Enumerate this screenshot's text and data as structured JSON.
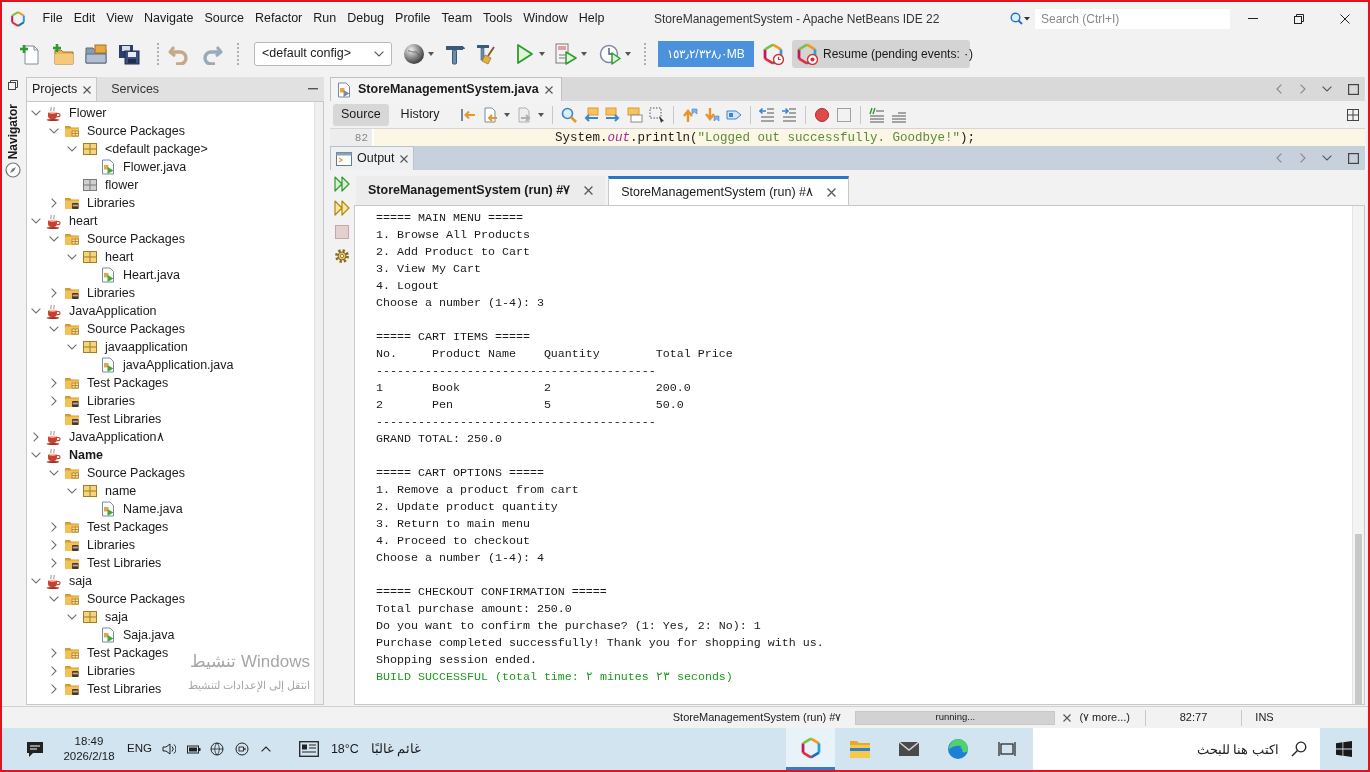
{
  "window": {
    "title": "StoreManagementSystem - Apache NetBeans IDE 22"
  },
  "menu": [
    "File",
    "Edit",
    "View",
    "Navigate",
    "Source",
    "Refactor",
    "Run",
    "Debug",
    "Profile",
    "Team",
    "Tools",
    "Window",
    "Help"
  ],
  "search": {
    "placeholder": "Search (Ctrl+I)"
  },
  "toolbar": {
    "config": "<default config>",
    "memory": "١٥٣٫٢/٣٢٨٫٠MB",
    "resume": "Resume (pending events: ٠)"
  },
  "navigator": {
    "label": "Navigator"
  },
  "projects_panel": {
    "tabs": [
      {
        "label": "Projects",
        "selected": true
      },
      {
        "label": "Services",
        "selected": false
      }
    ],
    "tree": [
      {
        "label": "Flower",
        "kind": "project",
        "main": false,
        "expanded": true,
        "children": [
          {
            "label": "Source Packages",
            "kind": "source-packages",
            "expanded": true,
            "children": [
              {
                "label": "<default package>",
                "kind": "package",
                "expanded": true,
                "children": [
                  {
                    "label": "Flower.java",
                    "kind": "java-file"
                  }
                ]
              },
              {
                "label": "flower",
                "kind": "empty-package"
              }
            ]
          },
          {
            "label": "Libraries",
            "kind": "libraries",
            "expanded": false
          }
        ]
      },
      {
        "label": "heart",
        "kind": "project",
        "main": false,
        "expanded": true,
        "children": [
          {
            "label": "Source Packages",
            "kind": "source-packages",
            "expanded": true,
            "children": [
              {
                "label": "heart",
                "kind": "package",
                "expanded": true,
                "children": [
                  {
                    "label": "Heart.java",
                    "kind": "java-file"
                  }
                ]
              }
            ]
          },
          {
            "label": "Libraries",
            "kind": "libraries",
            "expanded": false
          }
        ]
      },
      {
        "label": "JavaApplication",
        "kind": "project",
        "main": false,
        "expanded": true,
        "children": [
          {
            "label": "Source Packages",
            "kind": "source-packages",
            "expanded": true,
            "children": [
              {
                "label": "javaapplication",
                "kind": "package",
                "expanded": true,
                "children": [
                  {
                    "label": "javaApplication.java",
                    "kind": "java-file"
                  }
                ]
              }
            ]
          },
          {
            "label": "Test Packages",
            "kind": "test-packages",
            "expanded": false
          },
          {
            "label": "Libraries",
            "kind": "libraries",
            "expanded": false
          },
          {
            "label": "Test Libraries",
            "kind": "test-libraries"
          }
        ]
      },
      {
        "label": "JavaApplication٨",
        "kind": "project",
        "main": false,
        "expanded": false
      },
      {
        "label": "Name",
        "kind": "project",
        "main": true,
        "expanded": true,
        "children": [
          {
            "label": "Source Packages",
            "kind": "source-packages",
            "expanded": true,
            "children": [
              {
                "label": "name",
                "kind": "package",
                "expanded": true,
                "children": [
                  {
                    "label": "Name.java",
                    "kind": "java-file"
                  }
                ]
              }
            ]
          },
          {
            "label": "Test Packages",
            "kind": "test-packages",
            "expanded": false
          },
          {
            "label": "Libraries",
            "kind": "libraries",
            "expanded": false
          },
          {
            "label": "Test Libraries",
            "kind": "test-libraries",
            "expanded": false
          }
        ]
      },
      {
        "label": "saja",
        "kind": "project",
        "main": false,
        "expanded": true,
        "children": [
          {
            "label": "Source Packages",
            "kind": "source-packages",
            "expanded": true,
            "children": [
              {
                "label": "saja",
                "kind": "package",
                "expanded": true,
                "children": [
                  {
                    "label": "Saja.java",
                    "kind": "java-file"
                  }
                ]
              }
            ]
          },
          {
            "label": "Test Packages",
            "kind": "test-packages",
            "expanded": false
          },
          {
            "label": "Libraries",
            "kind": "libraries",
            "expanded": false
          },
          {
            "label": "Test Libraries",
            "kind": "test-libraries",
            "expanded": false
          }
        ]
      }
    ]
  },
  "activation_notice": {
    "title": "تنشيط Windows",
    "text": "انتقل إلى الإعدادات لتنشيط"
  },
  "editor": {
    "tabs": [
      {
        "label": "StoreManagementSystem.java",
        "selected": true
      }
    ],
    "views": [
      {
        "label": "Source",
        "selected": true
      },
      {
        "label": "History",
        "selected": false
      }
    ],
    "code_line": {
      "number": "82",
      "tokens": [
        {
          "text": "System.",
          "kind": "plain"
        },
        {
          "text": "out",
          "kind": "field"
        },
        {
          "text": ".println(",
          "kind": "plain"
        },
        {
          "text": "\"Logged out successfully. Goodbye!\"",
          "kind": "string"
        },
        {
          "text": ");",
          "kind": "plain"
        }
      ]
    }
  },
  "output": {
    "title": "Output",
    "tabs": [
      {
        "label": "StoreManagementSystem (run) #٧",
        "selected": false,
        "running": true
      },
      {
        "label": "StoreManagementSystem (run) #٨",
        "selected": true,
        "running": false
      }
    ],
    "blocks": [
      [
        "===== MAIN MENU =====",
        "1. Browse All Products",
        "2. Add Product to Cart",
        "3. View My Cart",
        "4. Logout",
        "Choose a number (1-4): 3"
      ],
      [
        "===== CART ITEMS =====",
        "No.     Product Name    Quantity        Total Price",
        "----------------------------------------",
        "1       Book            2               200.0",
        "2       Pen             5               50.0",
        "----------------------------------------",
        "GRAND TOTAL: 250.0"
      ],
      [
        "===== CART OPTIONS =====",
        "1. Remove a product from cart",
        "2. Update product quantity",
        "3. Return to main menu",
        "4. Proceed to checkout",
        "Choose a number (1-4): 4"
      ],
      [
        "===== CHECKOUT CONFIRMATION =====",
        "Total purchase amount: 250.0",
        "Do you want to confirm the purchase? (1: Yes, 2: No): 1",
        "Purchase completed successfully! Thank you for shopping with us.",
        "Shopping session ended."
      ]
    ],
    "build_status": {
      "text": "BUILD SUCCESSFUL (total time: ٢ minutes ٢٣ seconds)",
      "kind": "success"
    }
  },
  "status_bar": {
    "task": "StoreManagementSystem (run) #٧",
    "progress": {
      "label": "running...",
      "level": 1
    },
    "more": "(٧ more...)",
    "position": "82:77",
    "mode": "INS"
  },
  "taskbar": {
    "time": "18:49",
    "date": "2026/2/18",
    "language": "ENG",
    "temperature": "18°C",
    "weather": "غائم غالبًا",
    "search": {
      "placeholder": "اكتب هنا للبحث"
    },
    "apps": [
      {
        "kind": "netbeans",
        "selected": true
      },
      {
        "kind": "folder",
        "selected": false
      },
      {
        "kind": "mail",
        "selected": false
      },
      {
        "kind": "browser",
        "selected": false
      }
    ]
  }
}
